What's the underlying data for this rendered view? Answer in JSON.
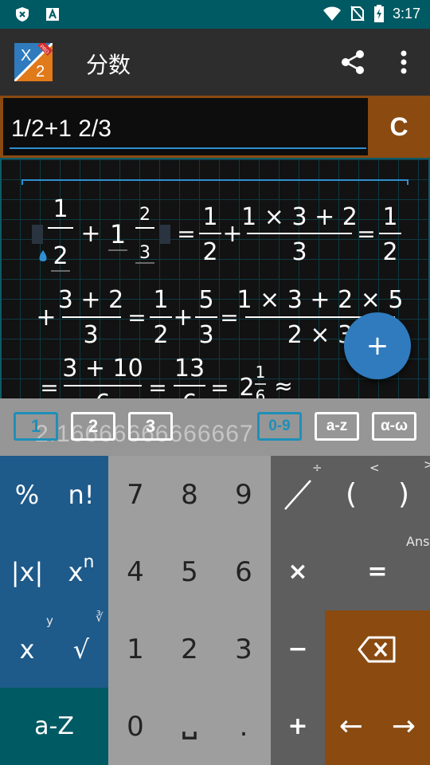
{
  "status_bar": {
    "time": "3:17",
    "icons": [
      "shield-x-icon",
      "a-box-icon",
      "wifi-icon",
      "no-sim-icon",
      "battery-charging-icon"
    ]
  },
  "app_bar": {
    "title": "分数",
    "logo": {
      "top_text": "X",
      "bottom_text": "2",
      "badge": "PRO"
    },
    "actions": [
      "share-icon",
      "more-vert-icon"
    ]
  },
  "input": {
    "value": "1/2+1 2/3",
    "clear_label": "C"
  },
  "result": {
    "lhs": {
      "num": "1",
      "den": "2",
      "plus": "+",
      "whole": "1",
      "mixed_num": "2",
      "mixed_den": "3"
    },
    "line1": {
      "eq": "=",
      "t1_num": "1",
      "t1_den": "2",
      "plus": "+",
      "t2_num": "1 × 3 + 2",
      "t2_den": "3",
      "t3_num": "1",
      "t3_den": "2"
    },
    "line2": {
      "plus": "+",
      "t1_num": "3 + 2",
      "t1_den": "3",
      "t2_num": "1",
      "t2_den": "2",
      "t3_num": "5",
      "t3_den": "3",
      "t4_num": "1 × 3 + 2 × 5",
      "t4_den": "2 × 3"
    },
    "line3": {
      "t1_num": "3 + 10",
      "t1_den": "6",
      "t2_num": "13",
      "t2_den": "6",
      "whole": "2",
      "mixed_num": "1",
      "mixed_den": "6",
      "approx": "≈"
    },
    "decimal": "2.16666666666667",
    "fab_label": "+"
  },
  "tabs": [
    {
      "label": "1",
      "active": true
    },
    {
      "label": "2",
      "active": false
    },
    {
      "label": "3",
      "active": false
    },
    {
      "label": "0-9",
      "active": true
    },
    {
      "label": "a-z",
      "active": false
    },
    {
      "label": "α-ω",
      "active": false
    }
  ],
  "keypad": {
    "percent": "%",
    "factorial": "n!",
    "abs": "|x|",
    "power_base": "x",
    "power_exp": "n",
    "root_x": "x",
    "root_y": "y",
    "sqrt": "√",
    "nth_root_hint": "∛",
    "alpha": "a-Z",
    "d7": "7",
    "d8": "8",
    "d9": "9",
    "d4": "4",
    "d5": "5",
    "d6": "6",
    "d1": "1",
    "d2": "2",
    "d3": "3",
    "d0": "0",
    "space": "␣",
    "dot": ".",
    "div_hint": "÷",
    "lparen": "(",
    "lparen_hint": "<",
    "rparen": ")",
    "rparen_hint": ">",
    "multiply": "×",
    "equals": "=",
    "ans_hint": "Ans",
    "minus": "−",
    "plus": "+",
    "backspace": "backspace-icon",
    "left": "←",
    "right": "→"
  },
  "colors": {
    "status": "#005a63",
    "appbar": "#2d2d2d",
    "accent_orange": "#8a4a10",
    "accent_blue": "#1e5a8a",
    "fab": "#2f7bbd",
    "input_line": "#2f8fd0"
  }
}
